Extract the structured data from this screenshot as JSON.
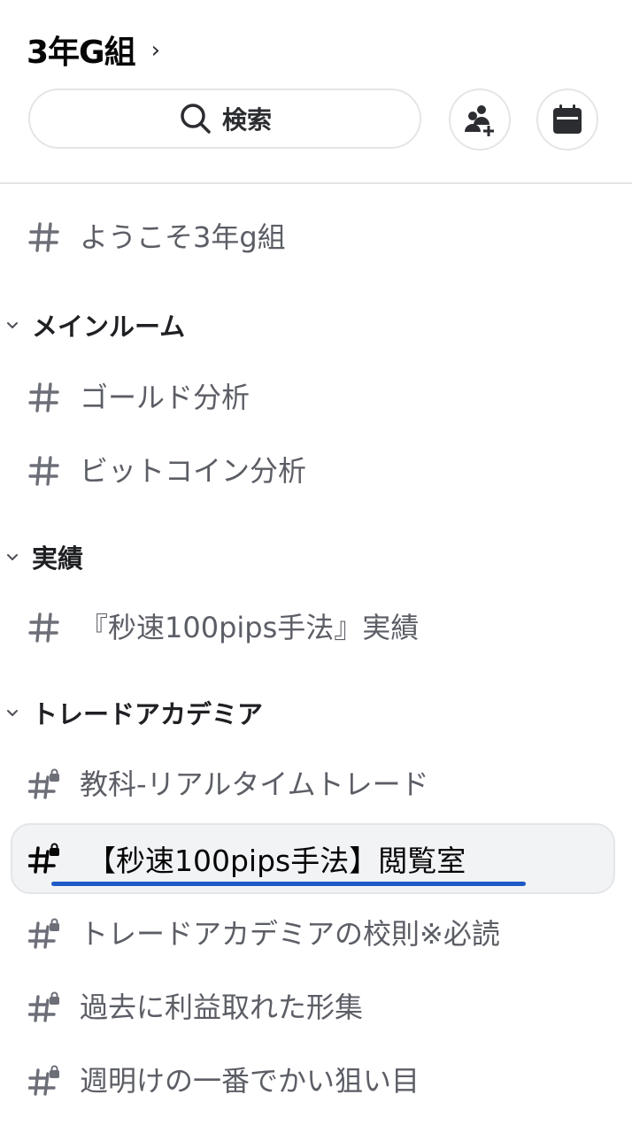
{
  "header": {
    "server_name": "3年G組",
    "search_label": "検索",
    "colors": {
      "accent_underline": "#1e5bc6",
      "selected_bg": "#f2f3f5"
    }
  },
  "channels_top": [
    {
      "name": "ようこそ3年g組",
      "icon": "hash-icon"
    }
  ],
  "categories": [
    {
      "name": "メインルーム",
      "channels": [
        {
          "name": "ゴールド分析",
          "icon": "hash-icon"
        },
        {
          "name": "ビットコイン分析",
          "icon": "hash-icon"
        }
      ]
    },
    {
      "name": "実績",
      "channels": [
        {
          "name": "『秒速100pips手法』実績",
          "icon": "hash-icon"
        }
      ]
    },
    {
      "name": "トレードアカデミア",
      "channels": [
        {
          "name": "教科-リアルタイムトレード",
          "icon": "locked-hash-icon"
        },
        {
          "name": "【秒速100pips手法】閲覧室",
          "icon": "locked-hash-icon",
          "selected": true
        },
        {
          "name": "トレードアカデミアの校則※必読",
          "icon": "locked-hash-icon"
        },
        {
          "name": "過去に利益取れた形集",
          "icon": "locked-hash-icon"
        },
        {
          "name": "週明けの一番でかい狙い目",
          "icon": "locked-hash-icon"
        }
      ]
    }
  ]
}
